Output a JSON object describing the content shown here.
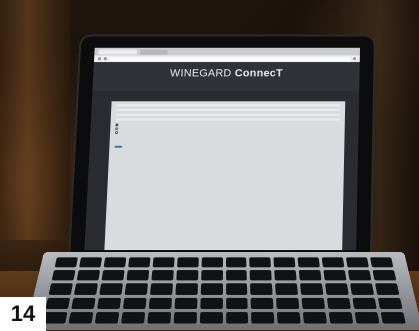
{
  "badge": {
    "number": "14"
  },
  "screen": {
    "brand_part1": "WINEGARD",
    "brand_part2": " ConnecT",
    "menu_label": "Ҷ"
  },
  "form": {
    "fields": [
      {
        "label": "",
        "value": ""
      },
      {
        "label": "",
        "value": ""
      },
      {
        "label": "",
        "value": ""
      },
      {
        "label": "",
        "value": ""
      }
    ],
    "radio_options": [
      "",
      "",
      ""
    ],
    "button_label": ""
  }
}
